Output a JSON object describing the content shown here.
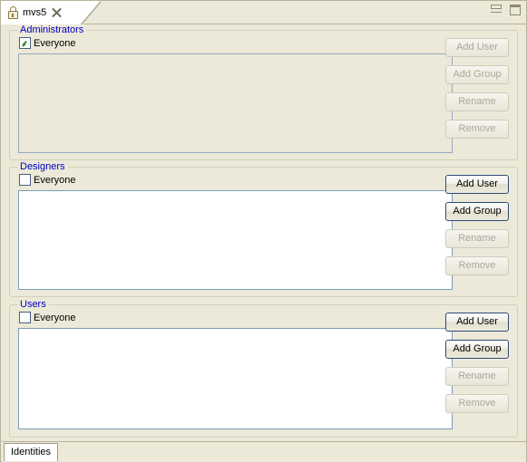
{
  "window": {
    "editor_tab": {
      "label": "mvs5",
      "lock_icon": "lock-icon",
      "close_icon": "close-x-icon"
    },
    "controls": {
      "minimize_icon": "minimize-icon",
      "maximize_icon": "maximize-icon"
    },
    "colors": {
      "background": "#ece9d8",
      "group_title": "#0000c8",
      "listbox_border": "#7d9cbb",
      "checkmark": "#2e8b2e",
      "tab_active": "#ffffff"
    }
  },
  "groups": [
    {
      "title": "Administrators",
      "everyone_label": "Everyone",
      "everyone_checked": true,
      "list_enabled": false,
      "list_items": [],
      "buttons": [
        {
          "label": "Add User",
          "enabled": false
        },
        {
          "label": "Add Group",
          "enabled": false
        },
        {
          "label": "Rename",
          "enabled": false
        },
        {
          "label": "Remove",
          "enabled": false
        }
      ]
    },
    {
      "title": "Designers",
      "everyone_label": "Everyone",
      "everyone_checked": false,
      "list_enabled": true,
      "list_items": [],
      "buttons": [
        {
          "label": "Add User",
          "enabled": true
        },
        {
          "label": "Add Group",
          "enabled": true
        },
        {
          "label": "Rename",
          "enabled": false
        },
        {
          "label": "Remove",
          "enabled": false
        }
      ]
    },
    {
      "title": "Users",
      "everyone_label": "Everyone",
      "everyone_checked": false,
      "list_enabled": true,
      "list_items": [],
      "buttons": [
        {
          "label": "Add User",
          "enabled": true
        },
        {
          "label": "Add Group",
          "enabled": true
        },
        {
          "label": "Rename",
          "enabled": false
        },
        {
          "label": "Remove",
          "enabled": false
        }
      ]
    }
  ],
  "bottom_tabs": [
    {
      "label": "Identities",
      "active": true
    }
  ]
}
